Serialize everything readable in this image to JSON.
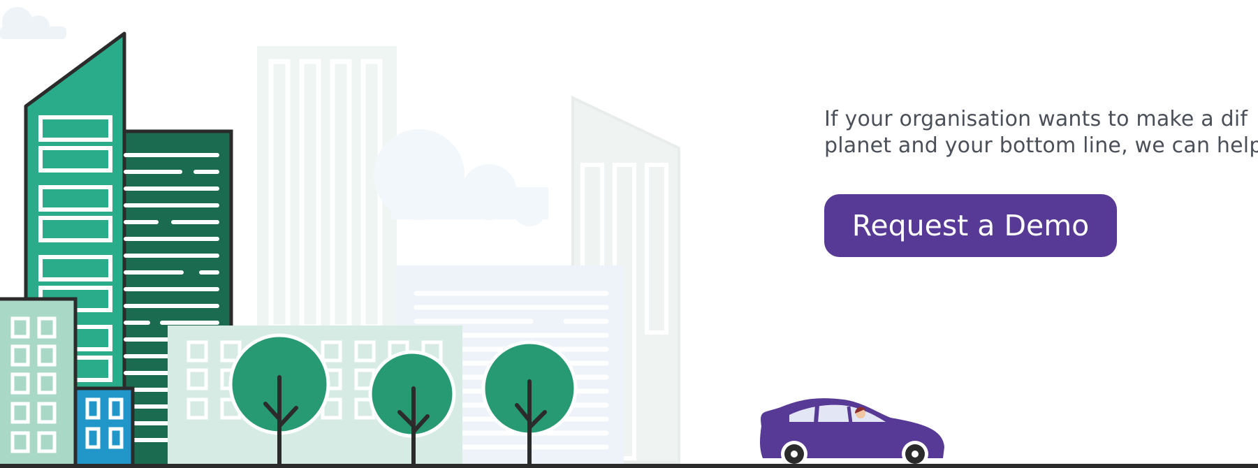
{
  "cta": {
    "line1": "If your organisation wants to make a dif",
    "line2": "planet and your bottom line, we can help",
    "button_label": "Request a Demo"
  },
  "illustration": {
    "description_icons": [
      "cloud-icon",
      "building-icon",
      "tree-icon",
      "car-icon",
      "driver-icon"
    ]
  },
  "colors": {
    "primary": "#573a96",
    "teal": "#2aab8a",
    "dark_green": "#1b6b50",
    "tree_green": "#279a74",
    "mint": "#d5ebe3",
    "blue_block": "#2196c9",
    "car": "#573a96",
    "text": "#4a4f58"
  }
}
